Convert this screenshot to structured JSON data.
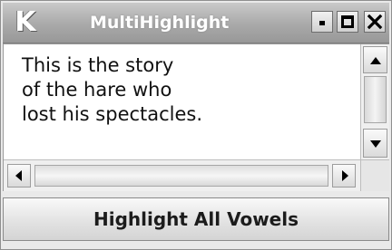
{
  "window": {
    "title": "MultiHighlight",
    "app_icon_glyph": "K",
    "app_icon": "kde-k-icon",
    "controls": {
      "minimize": "minimize-icon",
      "maximize": "maximize-icon",
      "close": "close-icon"
    }
  },
  "textarea": {
    "text": "This is the story\nof the hare who\nlost his spectacles."
  },
  "scrollbars": {
    "vertical": {
      "up": "arrow-up-icon",
      "down": "arrow-down-icon"
    },
    "horizontal": {
      "left": "arrow-left-icon",
      "right": "arrow-right-icon"
    }
  },
  "actions": {
    "highlight_label": "Highlight All Vowels"
  },
  "colors": {
    "titlebar": "#a9a9a9",
    "title_text": "#ffffff",
    "text_background": "#ffffff",
    "window_background": "#e9e9e9"
  }
}
